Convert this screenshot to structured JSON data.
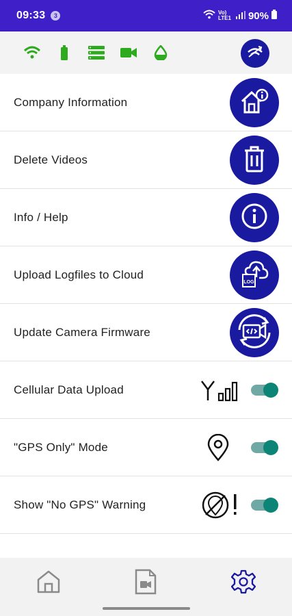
{
  "status_bar": {
    "time": "09:33",
    "notification_count": "3",
    "battery": "90%",
    "network": "Vo) LTE1"
  },
  "top_bar": {
    "indicators": [
      "wifi-icon",
      "battery-icon",
      "storage-icon",
      "camera-icon",
      "water-drop-icon"
    ],
    "indicator_color": "#2eaa1e",
    "action_icon": "sync-icon"
  },
  "menu": {
    "items": [
      {
        "label": "Company Information",
        "icon": "company-info-icon"
      },
      {
        "label": "Delete Videos",
        "icon": "trash-icon"
      },
      {
        "label": "Info / Help",
        "icon": "info-icon"
      },
      {
        "label": "Upload Logfiles to Cloud",
        "icon": "cloud-upload-icon"
      },
      {
        "label": "Update Camera Firmware",
        "icon": "firmware-update-icon"
      }
    ],
    "toggles": [
      {
        "label": "Cellular Data Upload",
        "icon": "cellular-signal-icon",
        "on": true
      },
      {
        "label": "\"GPS Only\" Mode",
        "icon": "location-pin-icon",
        "on": true
      },
      {
        "label": "Show \"No GPS\" Warning",
        "icon": "no-gps-warning-icon",
        "on": true
      }
    ]
  },
  "bottom_nav": {
    "items": [
      {
        "name": "home",
        "icon": "home-icon",
        "active": false
      },
      {
        "name": "videos",
        "icon": "video-file-icon",
        "active": false
      },
      {
        "name": "settings",
        "icon": "gear-icon",
        "active": true
      }
    ],
    "active_color": "#1a1aa0",
    "inactive_color": "#8a8a8a"
  },
  "colors": {
    "status_bar": "#3f1fc7",
    "accent": "#1a1aa0",
    "toggle_on": "#0c8577"
  }
}
